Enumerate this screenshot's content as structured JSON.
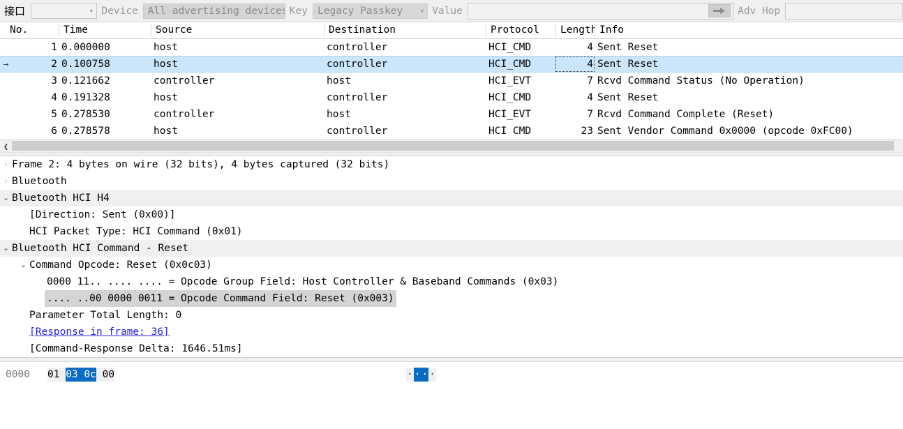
{
  "toolbar": {
    "interface_label": "接口",
    "interface_value": "",
    "device_label": "Device",
    "device_value": "All advertising devices",
    "key_label": "Key",
    "key_value": "Legacy Passkey",
    "value_label": "Value",
    "value_input": "",
    "submit_icon": "arrow-right-icon",
    "adv_hop_label": "Adv Hop",
    "adv_hop_value": ""
  },
  "packet_list": {
    "columns": [
      {
        "label": "No."
      },
      {
        "label": "Time"
      },
      {
        "label": "Source"
      },
      {
        "label": "Destination"
      },
      {
        "label": "Protocol"
      },
      {
        "label": "Length"
      },
      {
        "label": "Info"
      }
    ],
    "rows": [
      {
        "marker": "",
        "no": "1",
        "time": "0.000000",
        "source": "host",
        "destination": "controller",
        "protocol": "HCI_CMD",
        "length": "4",
        "info": "Sent Reset",
        "selected": false
      },
      {
        "marker": "→",
        "no": "2",
        "time": "0.100758",
        "source": "host",
        "destination": "controller",
        "protocol": "HCI_CMD",
        "length": "4",
        "info": "Sent Reset",
        "selected": true
      },
      {
        "marker": "",
        "no": "3",
        "time": "0.121662",
        "source": "controller",
        "destination": "host",
        "protocol": "HCI_EVT",
        "length": "7",
        "info": "Rcvd Command Status (No Operation)",
        "selected": false
      },
      {
        "marker": "",
        "no": "4",
        "time": "0.191328",
        "source": "host",
        "destination": "controller",
        "protocol": "HCI_CMD",
        "length": "4",
        "info": "Sent Reset",
        "selected": false
      },
      {
        "marker": "",
        "no": "5",
        "time": "0.278530",
        "source": "controller",
        "destination": "host",
        "protocol": "HCI_EVT",
        "length": "7",
        "info": "Rcvd Command Complete (Reset)",
        "selected": false
      },
      {
        "marker": "",
        "no": "6",
        "time": "0.278578",
        "source": "host",
        "destination": "controller",
        "protocol": "HCI CMD",
        "length": "23",
        "info": "Sent Vendor Command 0x0000 (opcode 0xFC00)",
        "selected": false
      }
    ],
    "scroll_left_icon": "chevron-left-icon"
  },
  "detail_tree": {
    "rows": [
      {
        "indent": 0,
        "state": "collapsed",
        "label": "Frame 2: 4 bytes on wire (32 bits), 4 bytes captured (32 bits)",
        "band": false,
        "selected": false,
        "link": false
      },
      {
        "indent": 0,
        "state": "collapsed",
        "label": "Bluetooth",
        "band": false,
        "selected": false,
        "link": false
      },
      {
        "indent": 0,
        "state": "expanded",
        "label": "Bluetooth HCI H4",
        "band": true,
        "selected": false,
        "link": false
      },
      {
        "indent": 1,
        "state": "leaf",
        "label": "[Direction: Sent (0x00)]",
        "band": false,
        "selected": false,
        "link": false
      },
      {
        "indent": 1,
        "state": "leaf",
        "label": "HCI Packet Type: HCI Command (0x01)",
        "band": false,
        "selected": false,
        "link": false
      },
      {
        "indent": 0,
        "state": "expanded",
        "label": "Bluetooth HCI Command - Reset",
        "band": true,
        "selected": false,
        "link": false
      },
      {
        "indent": 1,
        "state": "expanded",
        "label": "Command Opcode: Reset (0x0c03)",
        "band": false,
        "selected": false,
        "link": false
      },
      {
        "indent": 2,
        "state": "leaf",
        "label": "0000 11.. .... .... = Opcode Group Field: Host Controller & Baseband Commands (0x03)",
        "band": false,
        "selected": false,
        "link": false
      },
      {
        "indent": 2,
        "state": "leaf",
        "label": ".... ..00 0000 0011 = Opcode Command Field: Reset (0x003)",
        "band": false,
        "selected": true,
        "link": false
      },
      {
        "indent": 1,
        "state": "leaf",
        "label": "Parameter Total Length: 0",
        "band": false,
        "selected": false,
        "link": false
      },
      {
        "indent": 1,
        "state": "leaf",
        "label": "[Response in frame: 36]",
        "band": false,
        "selected": false,
        "link": true
      },
      {
        "indent": 1,
        "state": "leaf",
        "label": "[Command-Response Delta: 1646.51ms]",
        "band": false,
        "selected": false,
        "link": false
      }
    ]
  },
  "bytes_pane": {
    "offset": "0000",
    "hex_bytes": [
      {
        "text": "01",
        "selected": false
      },
      {
        "text": "03",
        "selected": true
      },
      {
        "text": "0c",
        "selected": true
      },
      {
        "text": "00",
        "selected": false
      }
    ],
    "ascii_chars": [
      {
        "text": "·",
        "selected": false
      },
      {
        "text": "·",
        "selected": true
      },
      {
        "text": "·",
        "selected": true
      },
      {
        "text": "·",
        "selected": false
      }
    ]
  },
  "colors": {
    "selection_blue": "#cbe6fb",
    "hex_highlight": "#0a6cc4",
    "link": "#2222dd",
    "band_gray": "#f0f0f0",
    "selected_field_gray": "#d4d4d4"
  }
}
